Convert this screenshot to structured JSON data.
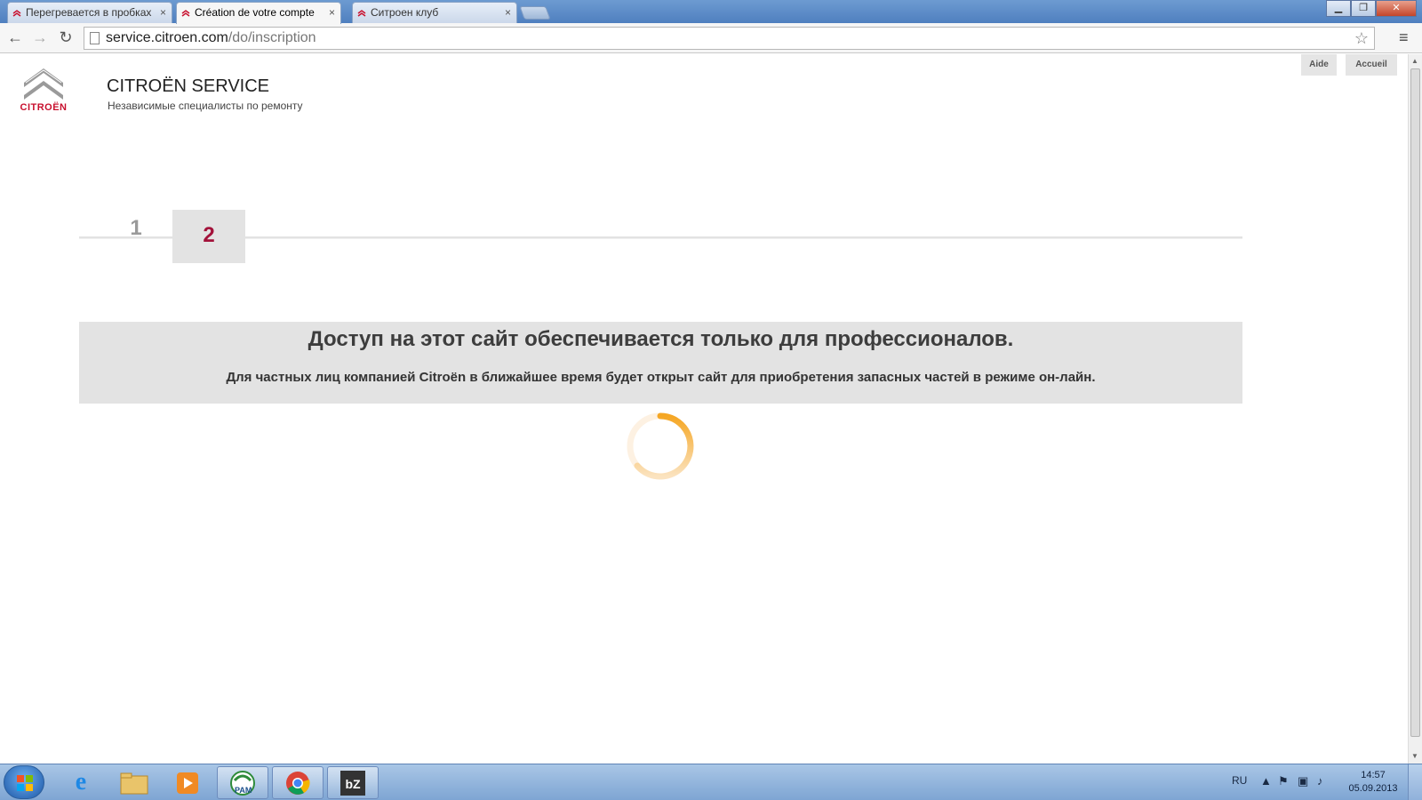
{
  "browser": {
    "tabs": [
      {
        "title": "Перегревается в пробках",
        "active": false
      },
      {
        "title": "Création de votre compte",
        "active": true
      },
      {
        "title": "Ситроен клуб",
        "active": false
      }
    ],
    "tab_close_glyph": "×",
    "url_host": "service.citroen.com",
    "url_path": "/do/inscription",
    "icons": [
      "back-icon",
      "forward-icon",
      "reload-icon",
      "page-icon",
      "bookmark-star-icon",
      "menu-icon"
    ]
  },
  "site": {
    "logo_word": "CITROËN",
    "title": "CITROËN SERVICE",
    "subtitle": "Независимые специалисты по ремонту",
    "top_links": [
      "Aide",
      "Accueil"
    ],
    "steps": [
      "1",
      "2"
    ],
    "active_step": "2",
    "notice_title": "Доступ на этот сайт обеспечивается только для профессионалов.",
    "notice_text": "Для частных лиц компанией Citroën в ближайшее время будет открыт сайт для приобретения запасных частей в режиме он-лайн.",
    "colors": {
      "brand_red": "#c8102e",
      "step_active": "#a3123a",
      "spinner": "#f5a623"
    }
  },
  "taskbar": {
    "pinned": [
      "internet-explorer-icon",
      "file-explorer-icon",
      "media-player-icon",
      "pam-icon",
      "chrome-icon",
      "filezilla-icon"
    ],
    "pam_label": "PAM",
    "lang": "RU",
    "time": "14:57",
    "date": "05.09.2013"
  }
}
